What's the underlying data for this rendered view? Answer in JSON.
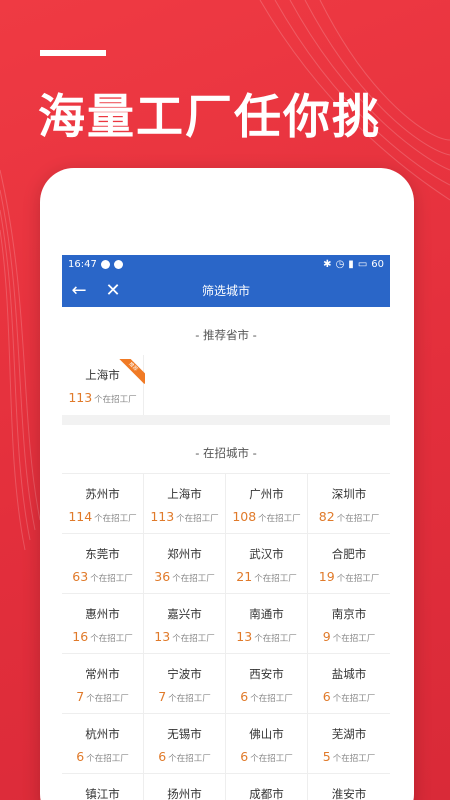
{
  "headline": "海量工厂任你挑",
  "status_bar": {
    "time": "16:47",
    "battery": "60"
  },
  "app_bar": {
    "back_icon": "←",
    "close_icon": "✕",
    "title": "筛选城市"
  },
  "recommended": {
    "title": "- 推荐省市 -",
    "items": [
      {
        "city": "上海市",
        "count": "113",
        "suffix": "个在招工厂",
        "badge": "推荐"
      }
    ]
  },
  "hiring": {
    "title": "- 在招城市 -",
    "items": [
      {
        "city": "苏州市",
        "count": "114",
        "suffix": "个在招工厂"
      },
      {
        "city": "上海市",
        "count": "113",
        "suffix": "个在招工厂"
      },
      {
        "city": "广州市",
        "count": "108",
        "suffix": "个在招工厂"
      },
      {
        "city": "深圳市",
        "count": "82",
        "suffix": "个在招工厂"
      },
      {
        "city": "东莞市",
        "count": "63",
        "suffix": "个在招工厂"
      },
      {
        "city": "郑州市",
        "count": "36",
        "suffix": "个在招工厂"
      },
      {
        "city": "武汉市",
        "count": "21",
        "suffix": "个在招工厂"
      },
      {
        "city": "合肥市",
        "count": "19",
        "suffix": "个在招工厂"
      },
      {
        "city": "惠州市",
        "count": "16",
        "suffix": "个在招工厂"
      },
      {
        "city": "嘉兴市",
        "count": "13",
        "suffix": "个在招工厂"
      },
      {
        "city": "南通市",
        "count": "13",
        "suffix": "个在招工厂"
      },
      {
        "city": "南京市",
        "count": "9",
        "suffix": "个在招工厂"
      },
      {
        "city": "常州市",
        "count": "7",
        "suffix": "个在招工厂"
      },
      {
        "city": "宁波市",
        "count": "7",
        "suffix": "个在招工厂"
      },
      {
        "city": "西安市",
        "count": "6",
        "suffix": "个在招工厂"
      },
      {
        "city": "盐城市",
        "count": "6",
        "suffix": "个在招工厂"
      },
      {
        "city": "杭州市",
        "count": "6",
        "suffix": "个在招工厂"
      },
      {
        "city": "无锡市",
        "count": "6",
        "suffix": "个在招工厂"
      },
      {
        "city": "佛山市",
        "count": "6",
        "suffix": "个在招工厂"
      },
      {
        "city": "芜湖市",
        "count": "5",
        "suffix": "个在招工厂"
      },
      {
        "city": "镇江市",
        "count": "",
        "suffix": ""
      },
      {
        "city": "扬州市",
        "count": "",
        "suffix": ""
      },
      {
        "city": "成都市",
        "count": "",
        "suffix": ""
      },
      {
        "city": "淮安市",
        "count": "",
        "suffix": ""
      }
    ]
  },
  "colors": {
    "background": "#e8303c",
    "app_bar": "#2a66c8",
    "count": "#e07a2a",
    "badge": "#f07a25"
  }
}
